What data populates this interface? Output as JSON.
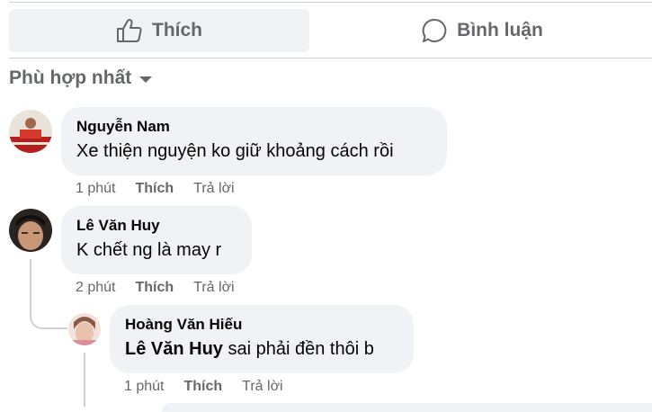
{
  "actions": {
    "like_label": "Thích",
    "comment_label": "Bình luận"
  },
  "sort": {
    "label": "Phù hợp nhất"
  },
  "comments": [
    {
      "author": "Nguyễn Nam",
      "text": "Xe thiện nguyện ko giữ khoảng cách rồi",
      "time": "1 phút",
      "like": "Thích",
      "reply": "Trả lời"
    },
    {
      "author": "Lê Văn Huy",
      "text": "K chết ng là may r",
      "time": "2 phút",
      "like": "Thích",
      "reply": "Trả lời"
    },
    {
      "author": "Hoàng Văn Hiếu",
      "mention": "Lê Văn Huy",
      "text": " sai phải đền thôi b",
      "time": "1 phút",
      "like": "Thích",
      "reply": "Trả lời"
    }
  ],
  "colors": {
    "bubble": "#f0f2f5",
    "secondary_text": "#65676b",
    "divider": "#ced0d4"
  }
}
